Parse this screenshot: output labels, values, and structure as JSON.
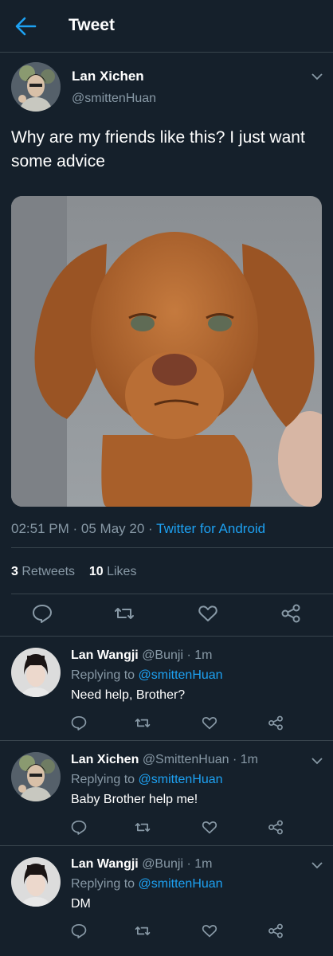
{
  "header": {
    "title": "Tweet",
    "back_icon": "arrow-left-icon",
    "accent": "#1da1f2"
  },
  "main_tweet": {
    "name": "Lan Xichen",
    "handle": "@smittenHuan",
    "text": "Why are my friends like this? I just want some advice",
    "photo_icon": "dog-photo",
    "time": "02:51 PM",
    "date": "05 May 20",
    "separator": "·",
    "source": "Twitter for Android",
    "retweets_count": "3",
    "retweets_label": "Retweets",
    "likes_count": "10",
    "likes_label": "Likes"
  },
  "replies": [
    {
      "name": "Lan Wangji",
      "handle": "@Bunji",
      "separator": "·",
      "time": "1m",
      "replying_label": "Replying to",
      "mention": "@smittenHuan",
      "text": "Need help, Brother?",
      "has_more": false
    },
    {
      "name": "Lan Xichen",
      "handle": "@SmittenHuan",
      "separator": "·",
      "time": "1m",
      "replying_label": "Replying to",
      "mention": "@smittenHuan",
      "text": "Baby Brother help me!",
      "has_more": true
    },
    {
      "name": "Lan Wangji",
      "handle": "@Bunji",
      "separator": "·",
      "time": "1m",
      "replying_label": "Replying to",
      "mention": "@smittenHuan",
      "text": "DM",
      "has_more": true
    }
  ],
  "colors": {
    "background": "#15202b",
    "muted": "#8899a6",
    "divider": "#38444d",
    "link": "#1da1f2"
  }
}
